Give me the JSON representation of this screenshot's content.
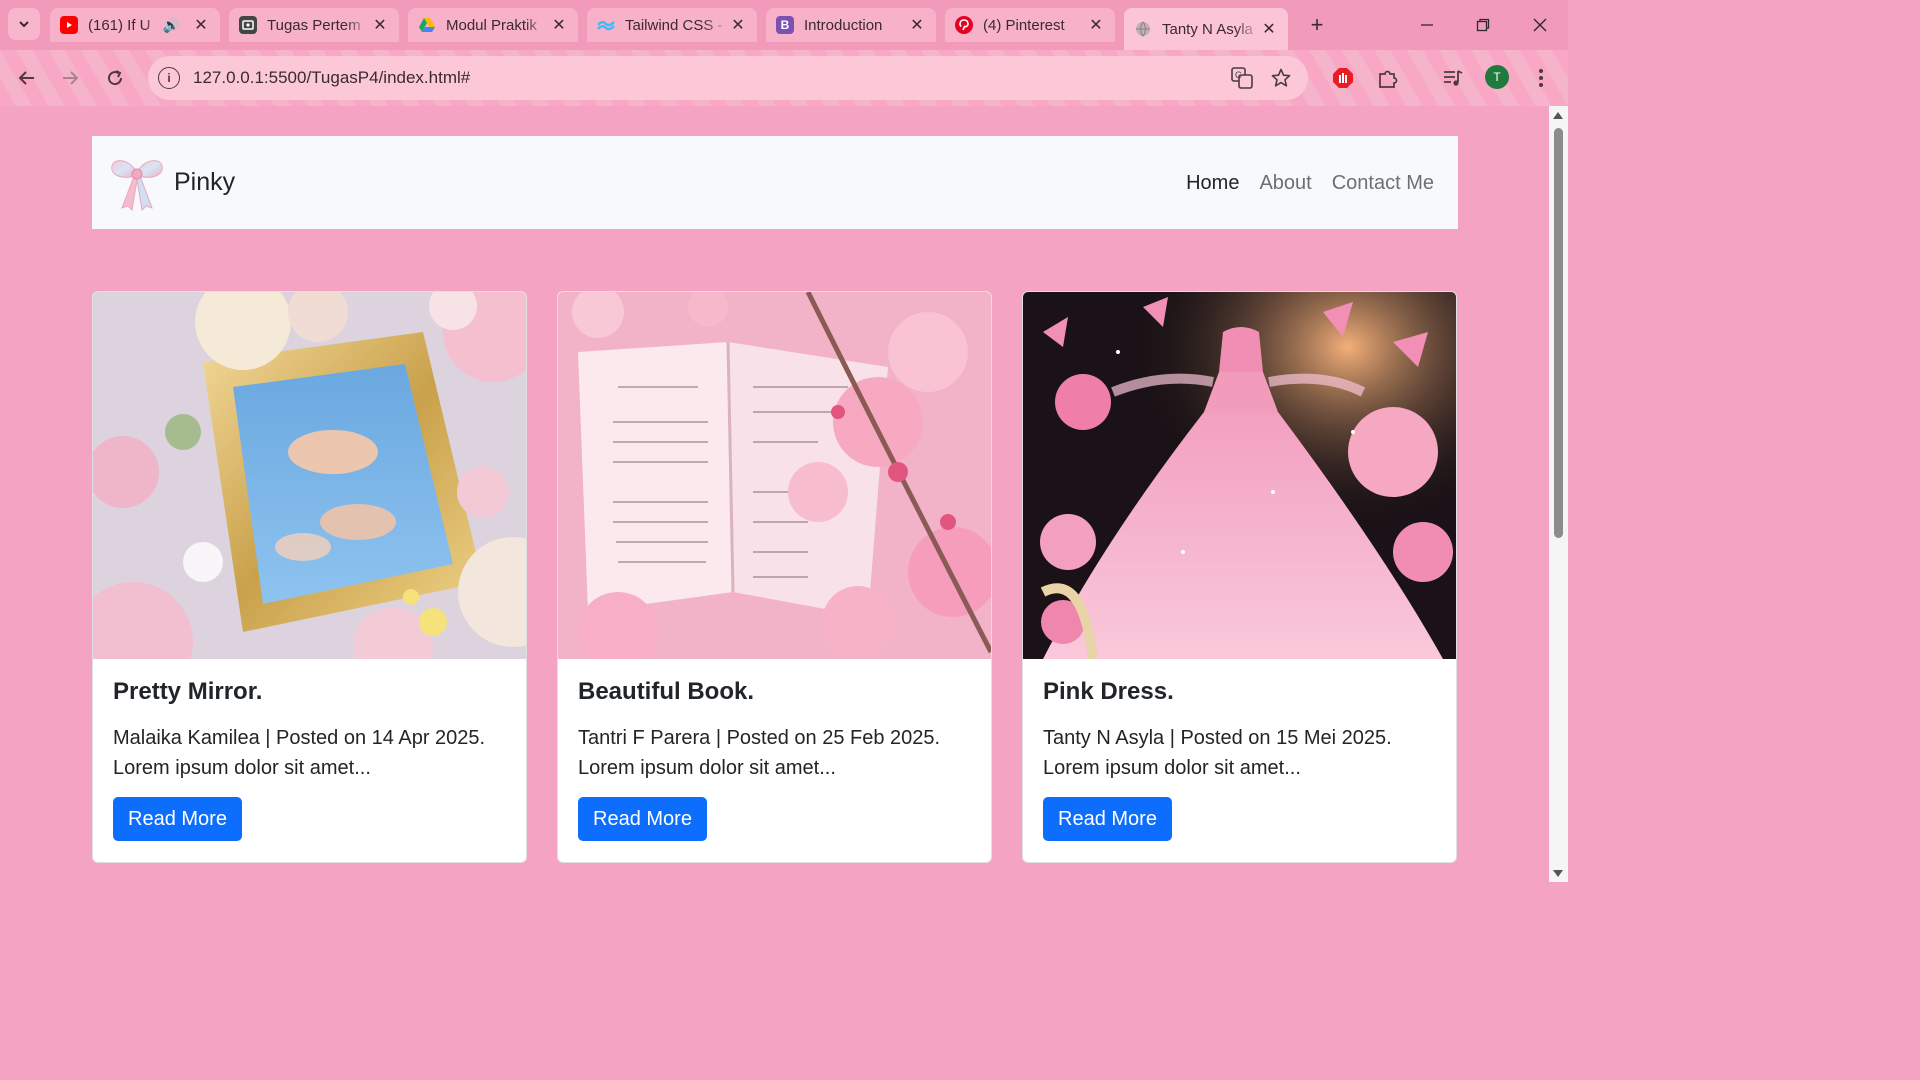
{
  "browser": {
    "tabs": [
      {
        "title": "(161) If U",
        "favicon": "youtube-icon",
        "favicon_color": "#ff0000",
        "audio": true
      },
      {
        "title": "Tugas Pertem",
        "favicon": "classroom-icon",
        "favicon_color": "#444444"
      },
      {
        "title": "Modul Praktik",
        "favicon": "drive-icon",
        "favicon_color": "#1fa463"
      },
      {
        "title": "Tailwind CSS -",
        "favicon": "tailwind-icon",
        "favicon_color": "#38bdf8"
      },
      {
        "title": "Introduction",
        "favicon": "bootstrap-icon",
        "favicon_color": "#7952b3",
        "glyph": "B"
      },
      {
        "title": "(4) Pinterest",
        "favicon": "pinterest-icon",
        "favicon_color": "#e60023"
      },
      {
        "title": "Tanty N Asyla",
        "favicon": "globe-icon",
        "favicon_color": "#9a8a90",
        "active": true
      }
    ],
    "url": "127.0.0.1:5500/TugasP4/index.html#",
    "profile_initial": "T"
  },
  "site": {
    "brand": "Pinky",
    "nav": [
      {
        "label": "Home",
        "active": true
      },
      {
        "label": "About"
      },
      {
        "label": "Contact Me"
      }
    ],
    "cards": [
      {
        "title": "Pretty Mirror.",
        "text": "Malaika Kamilea | Posted on 14 Apr 2025. Lorem ipsum dolor sit amet...",
        "button": "Read More",
        "image": "gold-mirror-with-flowers-image"
      },
      {
        "title": "Beautiful Book.",
        "text": "Tantri F Parera | Posted on 25 Feb 2025. Lorem ipsum dolor sit amet...",
        "button": "Read More",
        "image": "open-book-with-pink-blossoms-image"
      },
      {
        "title": "Pink Dress.",
        "text": "Tanty N Asyla | Posted on 15 Mei 2025. Lorem ipsum dolor sit amet...",
        "button": "Read More",
        "image": "pink-ball-gown-with-butterflies-image"
      }
    ]
  },
  "colors": {
    "page_bg": "#f5a3c3",
    "button_primary": "#0d6efd",
    "navbar_bg": "#f8f9fa"
  }
}
